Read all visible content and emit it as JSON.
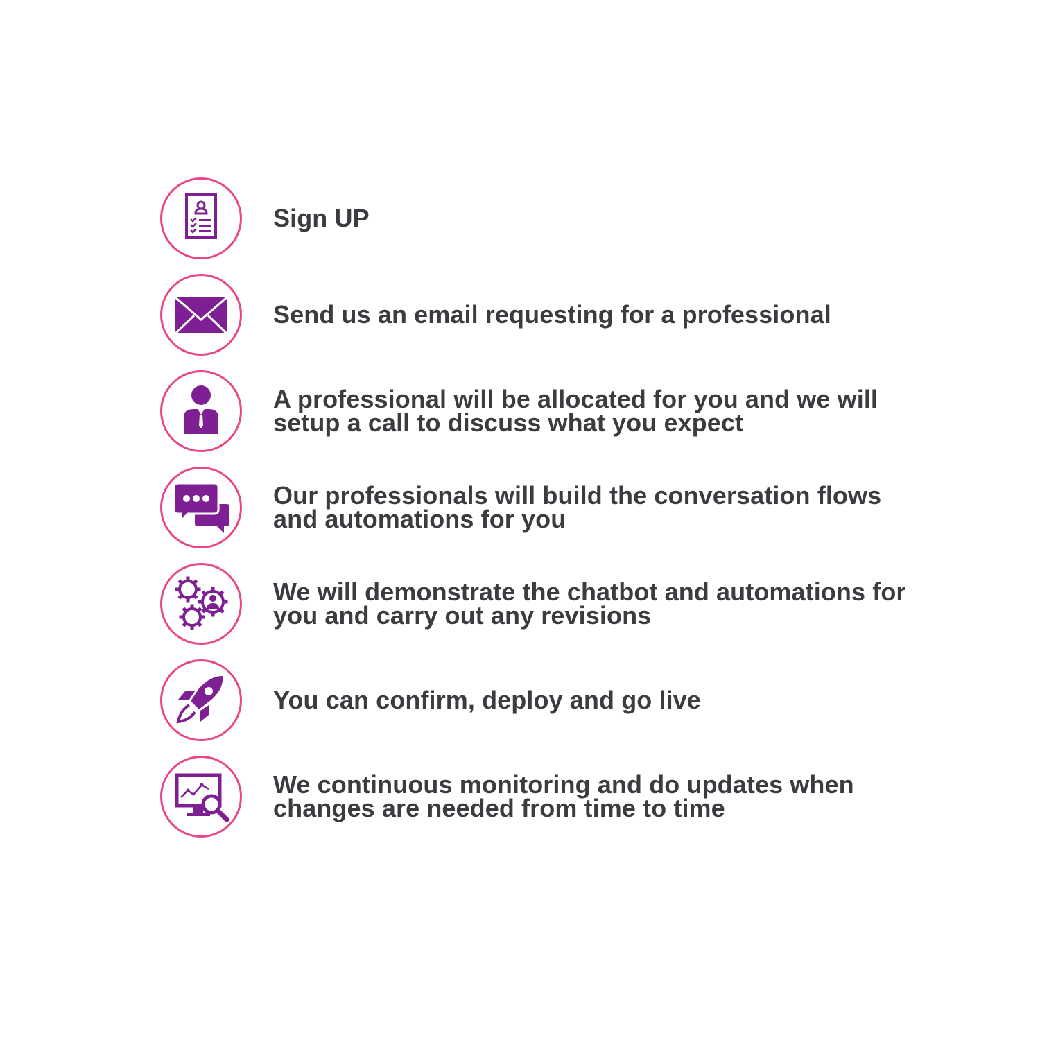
{
  "colors": {
    "ring": "#e9478a",
    "icon": "#7e2094",
    "text": "#3b3b40",
    "background": "#ffffff"
  },
  "steps": [
    {
      "icon": "signup-form-icon",
      "lines": [
        "Sign UP"
      ]
    },
    {
      "icon": "envelope-icon",
      "lines": [
        "Send us an email requesting for a professional"
      ]
    },
    {
      "icon": "businessman-icon",
      "lines": [
        "A professional will be allocated for you and we will",
        "setup a call to discuss what you expect"
      ]
    },
    {
      "icon": "chat-bubbles-icon",
      "lines": [
        "Our professionals will build the conversation flows",
        "and automations for you"
      ]
    },
    {
      "icon": "gears-person-icon",
      "lines": [
        "We will demonstrate the chatbot and automations for",
        "you and carry out any revisions"
      ]
    },
    {
      "icon": "rocket-icon",
      "lines": [
        "You can confirm, deploy and go live"
      ]
    },
    {
      "icon": "monitor-search-icon",
      "lines": [
        "We continuous monitoring and do updates when",
        "changes are needed from time to time"
      ]
    }
  ]
}
